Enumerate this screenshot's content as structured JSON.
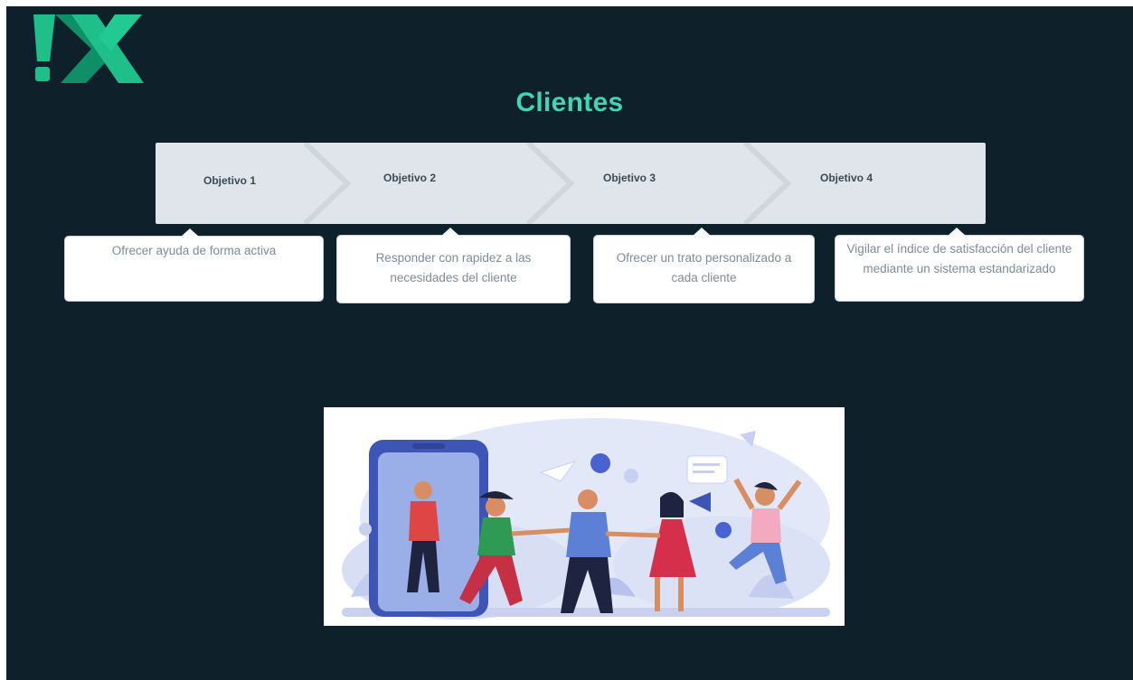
{
  "slide": {
    "title": "Clientes",
    "colors": {
      "background": "#0e212a",
      "title": "#3fd6b2",
      "logo_primary": "#1fbf8a",
      "logo_secondary": "#0f8f68",
      "process_bar": "#dfe5ea",
      "card_text": "#7e8c97"
    },
    "logo": {
      "icon": "dx-logo-icon"
    },
    "steps": [
      {
        "label": "Objetivo 1",
        "description": "Ofrecer ayuda de forma activa"
      },
      {
        "label": "Objetivo 2",
        "description": "Responder con rapidez a las necesidades del cliente"
      },
      {
        "label": "Objetivo 3",
        "description": "Ofrecer un trato personalizado a cada cliente"
      },
      {
        "label": "Objetivo 4",
        "description": "Vigilar el índice de satisfacción del cliente mediante un sistema estandarizado"
      }
    ],
    "illustration": {
      "icon": "customers-celebrating-illustration"
    }
  }
}
